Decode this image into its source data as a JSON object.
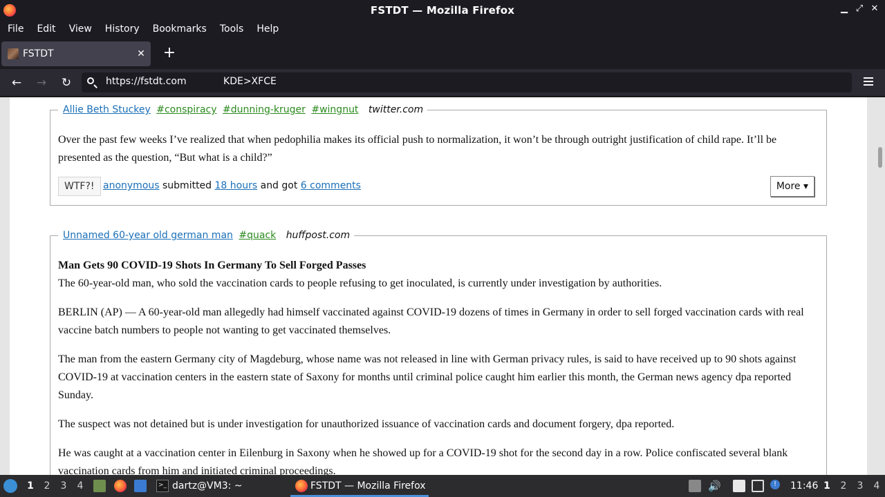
{
  "window": {
    "title": "FSTDT — Mozilla Firefox"
  },
  "menu": [
    "File",
    "Edit",
    "View",
    "History",
    "Bookmarks",
    "Tools",
    "Help"
  ],
  "tabs": [
    {
      "label": "FSTDT",
      "close": "✕"
    }
  ],
  "newtab_label": "+",
  "nav": {
    "back": "←",
    "forward": "→",
    "reload": "↻",
    "url": "https://fstdt.com            KDE>XFCE"
  },
  "quotes": [
    {
      "name": "Allie Beth Stuckey",
      "tags": [
        "#conspiracy",
        "#dunning-kruger",
        "#wingnut"
      ],
      "source": "twitter.com",
      "paragraphs": [
        "Over the past few weeks I’ve realized that when pedophilia makes its official push to normalization, it won’t be through outright justification of child rape. It’ll be presented as the question, “But what is a child?”"
      ],
      "footer": {
        "wtf_label": "WTF?!",
        "submitter": "anonymous",
        "submitted_text": "submitted",
        "time": "18 hours",
        "got_text": "and got",
        "comments": "6 comments",
        "more_label": "More ▾"
      }
    },
    {
      "name": "Unnamed 60-year old german man",
      "tags": [
        "#quack"
      ],
      "source": "huffpost.com",
      "headline": "Man Gets 90 COVID-19 Shots In Germany To Sell Forged Passes",
      "subhead": "The 60-year-old man, who sold the vaccination cards to people refusing to get inoculated, is currently under investigation by authorities.",
      "paragraphs": [
        "BERLIN (AP) — A 60-year-old man allegedly had himself vaccinated against COVID-19 dozens of times in Germany in order to sell forged vaccination cards with real vaccine batch numbers to people not wanting to get vaccinated themselves.",
        "The man from the eastern Germany city of Magdeburg, whose name was not released in line with German privacy rules, is said to have received up to 90 shots against COVID-19 at vaccination centers in the eastern state of Saxony for months until criminal police caught him earlier this month, the German news agency dpa reported Sunday.",
        "The suspect was not detained but is under investigation for unauthorized issuance of vaccination cards and document forgery, dpa reported.",
        "He was caught at a vaccination center in Eilenburg in Saxony when he showed up for a COVID-19 shot for the second day in a row. Police confiscated several blank vaccination cards from him and initiated criminal proceedings."
      ]
    }
  ],
  "taskbar": {
    "workspaces": [
      "1",
      "2",
      "3",
      "4"
    ],
    "terminal_task": "dartz@VM3: ~",
    "firefox_task": "FSTDT — Mozilla Firefox",
    "clock": "11:46",
    "right_workspaces": [
      "1",
      "2",
      "3",
      "4"
    ]
  },
  "colors": {
    "link": "#1a6fb8",
    "tag": "#2b8a1e",
    "chrome_dark": "#1c1b22"
  }
}
